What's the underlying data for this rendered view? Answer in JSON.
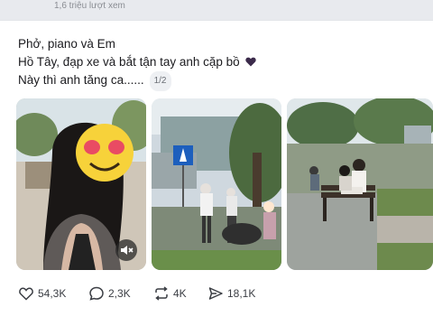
{
  "header": {
    "views": "1,6 triệu lượt xem"
  },
  "post": {
    "lines": [
      "Phở, piano và Em",
      "Hồ Tây, đạp xe và bắt tận tay anh cặp bồ",
      "Này thì anh tăng ca......"
    ],
    "media_counter": "1/2",
    "photos": [
      {
        "name": "selfie-photo"
      },
      {
        "name": "street-photo",
        "sign": "pedestrian-crossing"
      },
      {
        "name": "park-bench-photo"
      }
    ]
  },
  "actions": {
    "likes": "54,3K",
    "comments": "2,3K",
    "reposts": "4K",
    "shares": "18,1K"
  },
  "colors": {
    "accent_heart": "#3b2a4a",
    "background": "#e8eaee"
  }
}
